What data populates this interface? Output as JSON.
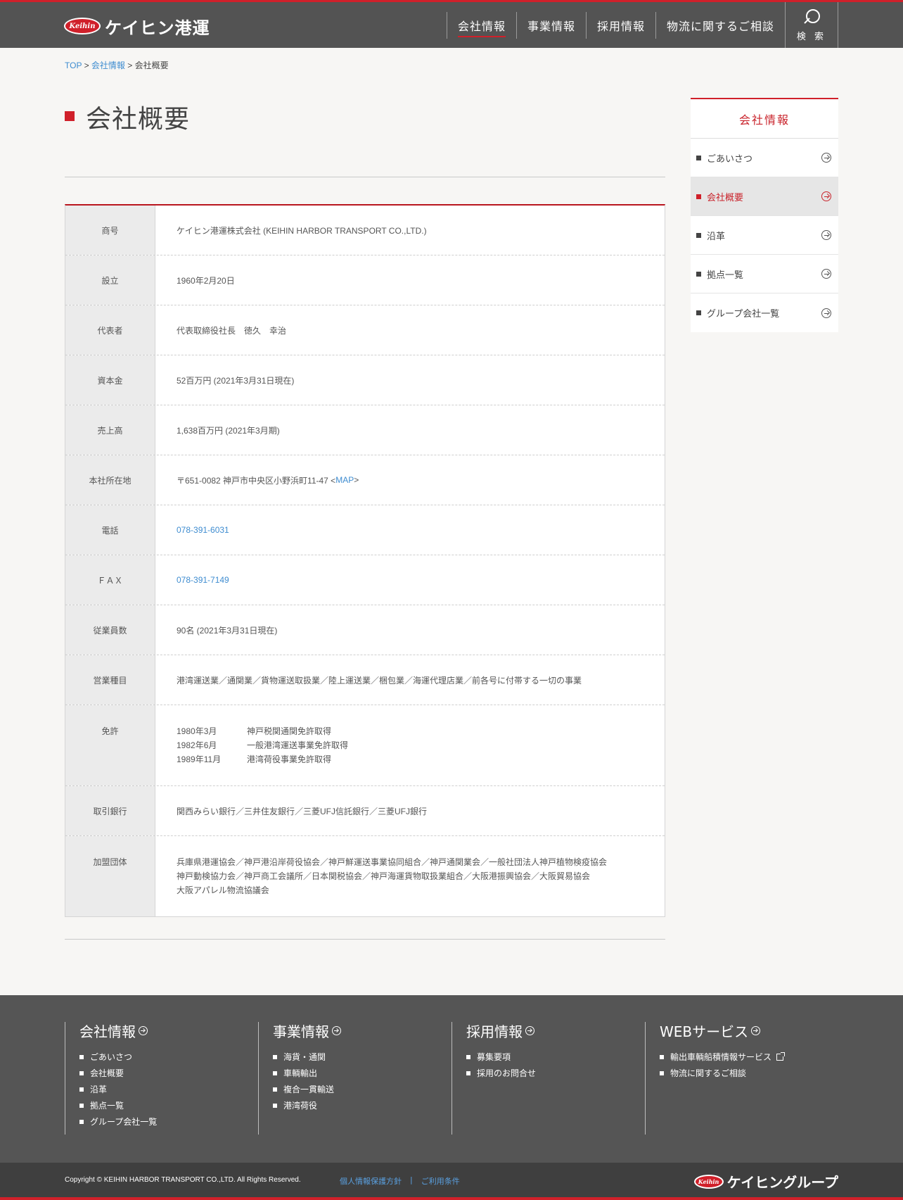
{
  "header": {
    "logo_badge": "Keihin",
    "logo_text": "ケイヒン港運",
    "nav": [
      "会社情報",
      "事業情報",
      "採用情報",
      "物流に関するご相談"
    ],
    "search_label": "検 索"
  },
  "breadcrumb": {
    "top": "TOP",
    "sep1": " > ",
    "company": "会社情報",
    "sep2": " > ",
    "current": "会社概要"
  },
  "page_title": "会社概要",
  "table": {
    "rows": [
      {
        "label": "商号",
        "value": "ケイヒン港運株式会社 (KEIHIN HARBOR TRANSPORT CO.,LTD.)"
      },
      {
        "label": "設立",
        "value": "1960年2月20日"
      },
      {
        "label": "代表者",
        "value": "代表取締役社長　徳久　幸治"
      },
      {
        "label": "資本金",
        "value": "52百万円 (2021年3月31日現在)"
      },
      {
        "label": "売上高",
        "value": "1,638百万円 (2021年3月期)"
      },
      {
        "label": "本社所在地",
        "value_prefix": "〒651-0082 神戸市中央区小野浜町11-47 <",
        "map_link": "MAP",
        "value_suffix": ">"
      },
      {
        "label": "電話",
        "value": "078-391-6031"
      },
      {
        "label": "ＦＡＸ",
        "value": "078-391-7149"
      },
      {
        "label": "従業員数",
        "value": "90名 (2021年3月31日現在)"
      },
      {
        "label": "営業種目",
        "value": "港湾運送業／通関業／貨物運送取扱業／陸上運送業／梱包業／海運代理店業／前各号に付帯する一切の事業"
      },
      {
        "label": "免許",
        "licenses": [
          {
            "date": "1980年3月",
            "text": "神戸税関通関免許取得"
          },
          {
            "date": "1982年6月",
            "text": "一般港湾運送事業免許取得"
          },
          {
            "date": "1989年11月",
            "text": "港湾荷役事業免許取得"
          }
        ]
      },
      {
        "label": "取引銀行",
        "value": "関西みらい銀行／三井住友銀行／三菱UFJ信託銀行／三菱UFJ銀行"
      },
      {
        "label": "加盟団体",
        "lines": [
          "兵庫県港運協会／神戸港沿岸荷役協会／神戸鮮運送事業協同組合／神戸通関業会／一般社団法人神戸植物検疫協会",
          "神戸動検協力会／神戸商工会議所／日本関税協会／神戸海運貨物取扱業組合／大阪港振興協会／大阪貿易協会",
          "大阪アパレル物流協議会"
        ]
      }
    ]
  },
  "side": {
    "heading": "会社情報",
    "items": [
      "ごあいさつ",
      "会社概要",
      "沿革",
      "拠点一覧",
      "グループ会社一覧"
    ]
  },
  "footer": {
    "cols": [
      {
        "title": "会社情報",
        "links": [
          "ごあいさつ",
          "会社概要",
          "沿革",
          "拠点一覧",
          "グループ会社一覧"
        ]
      },
      {
        "title": "事業情報",
        "links": [
          "海貨・通関",
          "車輌輸出",
          "複合一貫輸送",
          "港湾荷役"
        ]
      },
      {
        "title": "採用情報",
        "links": [
          "募集要項",
          "採用のお問合せ"
        ]
      },
      {
        "title": "WEBサービス",
        "links": [
          "輸出車輌船積情報サービス",
          "物流に関するご相談"
        ]
      }
    ],
    "copyright": "Copyright © KEIHIN HARBOR TRANSPORT CO.,LTD. All Rights Reserved.",
    "privacy": "個人情報保護方針",
    "divider": "|",
    "terms": "ご利用条件",
    "group_badge": "Keihin",
    "group_logo_text": "ケイヒングループ"
  },
  "colors": {
    "accent": "#d0202a",
    "link": "#3e8cd0",
    "header_bg": "#535353"
  }
}
